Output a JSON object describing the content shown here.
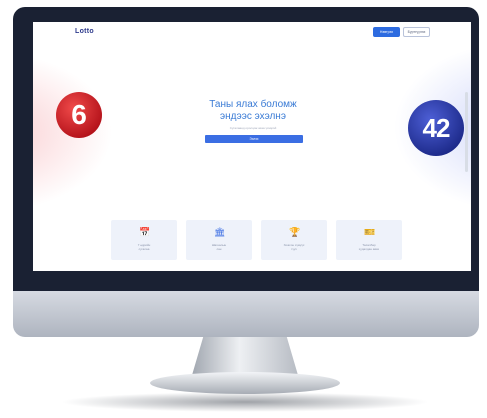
{
  "header": {
    "logo": "Lotto",
    "login_label": "Нэвтрэх",
    "register_label": "Бүртгүүлэх"
  },
  "hero": {
    "title_line1": "Таны ялах боломж",
    "title_line2": "эндээс эхэлнэ",
    "subtitle": "Сугалаанд оролцож азаа үзээрэй",
    "cta_label": "Эхлэх"
  },
  "balls": {
    "left": "6",
    "right": "42"
  },
  "cards": [
    {
      "icon": "calendar-icon",
      "glyph": "📅",
      "label_line1": "7 өдрийн",
      "label_line2": "сугалаа"
    },
    {
      "icon": "bank-icon",
      "glyph": "🏛",
      "label_line1": "Шагналын",
      "label_line2": "сан"
    },
    {
      "icon": "trophy-icon",
      "glyph": "🏆",
      "label_line1": "Хожсон хүмүүс",
      "label_line2": "түүх"
    },
    {
      "icon": "ticket-icon",
      "glyph": "🎫",
      "label_line1": "Тасалбар",
      "label_line2": "худалдан авах"
    }
  ],
  "colors": {
    "accent": "#3b6ee3",
    "bezel": "#1a2133",
    "ball_red": "#d11f27",
    "ball_blue": "#2a3aa6"
  }
}
